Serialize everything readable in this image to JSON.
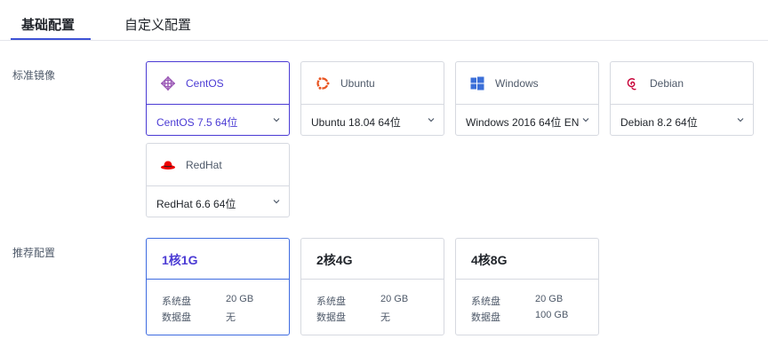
{
  "tabs": [
    {
      "label": "基础配置",
      "active": true
    },
    {
      "label": "自定义配置",
      "active": false
    }
  ],
  "colors": {
    "accent": "#4b3bd4",
    "selected_border": "#3e6be0",
    "border": "#d6d9e0"
  },
  "image_section": {
    "label": "标准镜像",
    "os_options": [
      {
        "name": "CentOS",
        "icon": "centos-icon",
        "version": "CentOS 7.5 64位",
        "selected": true
      },
      {
        "name": "Ubuntu",
        "icon": "ubuntu-icon",
        "version": "Ubuntu 18.04 64位",
        "selected": false
      },
      {
        "name": "Windows",
        "icon": "windows-icon",
        "version": "Windows 2016 64位 EN",
        "selected": false
      },
      {
        "name": "Debian",
        "icon": "debian-icon",
        "version": "Debian 8.2 64位",
        "selected": false
      },
      {
        "name": "RedHat",
        "icon": "redhat-icon",
        "version": "RedHat 6.6 64位",
        "selected": false
      }
    ]
  },
  "spec_section": {
    "label": "推荐配置",
    "system_disk_label": "系统盘",
    "data_disk_label": "数据盘",
    "specs": [
      {
        "title": "1核1G",
        "system_disk": "20 GB",
        "data_disk": "无",
        "selected": true
      },
      {
        "title": "2核4G",
        "system_disk": "20 GB",
        "data_disk": "无",
        "selected": false
      },
      {
        "title": "4核8G",
        "system_disk": "20 GB",
        "data_disk": "100 GB",
        "selected": false
      }
    ]
  }
}
